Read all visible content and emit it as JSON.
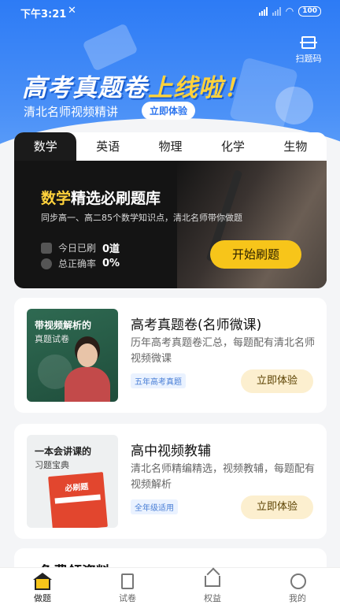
{
  "status": {
    "time": "下午3:21",
    "battery": "100"
  },
  "header": {
    "scan_label": "扫题码",
    "headline_main": "高考真题卷",
    "headline_accent": "上线啦！",
    "subline": "清北名师视频精讲",
    "try_label": "立即体验"
  },
  "subjects": [
    "数学",
    "英语",
    "物理",
    "化学",
    "生物"
  ],
  "feature": {
    "title_accent": "数学",
    "title_rest": "精选必刷题库",
    "desc": "同步高一、高二85个数学知识点，清北名师带你做题",
    "today_label": "今日已刷",
    "today_value": "0道",
    "accuracy_label": "总正确率",
    "accuracy_value": "0%",
    "start_label": "开始刷题"
  },
  "cards": [
    {
      "thumb_line1": "带视频解析的",
      "thumb_line2": "真题试卷",
      "title": "高考真题卷(名师微课)",
      "desc": "历年高考真题卷汇总，每题配有清北名师视频微课",
      "tag": "五年高考真题",
      "button": "立即体验"
    },
    {
      "thumb_line1": "一本会讲课的",
      "thumb_line2": "习题宝典",
      "book_title": "必刷题",
      "title": "高中视频教辅",
      "desc": "清北名师精编精选，视频教辅，每题配有视频解析",
      "tag": "全年级适用",
      "button": "立即体验"
    }
  ],
  "partial_section": {
    "title": "免费领资料"
  },
  "bottom_nav": [
    {
      "label": "做题",
      "icon": "home-icon"
    },
    {
      "label": "试卷",
      "icon": "paper-icon"
    },
    {
      "label": "权益",
      "icon": "crown-icon"
    },
    {
      "label": "我的",
      "icon": "profile-icon"
    }
  ],
  "colors": {
    "primary": "#2d7bf5",
    "accent": "#f7c51a",
    "dark": "#141414"
  }
}
